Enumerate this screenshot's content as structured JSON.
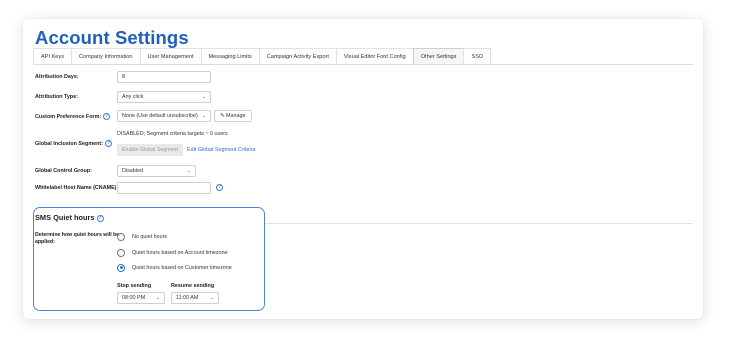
{
  "page": {
    "title": "Account Settings"
  },
  "tabs": [
    {
      "label": "API Keys"
    },
    {
      "label": "Company Information"
    },
    {
      "label": "User Management"
    },
    {
      "label": "Messaging Limits"
    },
    {
      "label": "Campaign Activity Export"
    },
    {
      "label": "Visual Editor Font Config"
    },
    {
      "label": "Other Settings",
      "active": true
    },
    {
      "label": "SSO"
    }
  ],
  "form": {
    "attribution_days": {
      "label": "Attribution Days:",
      "value": "8"
    },
    "attribution_type": {
      "label": "Attribution Type:",
      "value": "Any click"
    },
    "custom_preference_form": {
      "label": "Custom Preference Form:",
      "value": "None (Use default unsubscribe)",
      "manage_label": "Manage"
    },
    "global_inclusion_segment": {
      "label": "Global Inclusion Segment:",
      "status_text": "DISABLED; Segment criteria targets ~ 0 users",
      "enable_label": "Enable Global Segment",
      "edit_label": "Edit Global Segment Criteria"
    },
    "global_control_group": {
      "label": "Global Control Group:",
      "value": "Disabled"
    },
    "whitelabel_host": {
      "label": "Whitelabel Host Name (CNAME):",
      "value": ""
    }
  },
  "sms_quiet_hours": {
    "title": "SMS Quiet hours",
    "description": "Determine how quiet hours will be applied:",
    "options": [
      {
        "label": "No quiet hours",
        "checked": false
      },
      {
        "label": "Quiet hours based on Account timezone",
        "checked": false
      },
      {
        "label": "Quiet hours based on Customer timezone",
        "checked": true
      }
    ],
    "stop_sending": {
      "label": "Stop sending",
      "value": "08:00 PM"
    },
    "resume_sending": {
      "label": "Resume sending",
      "value": "11:00 AM"
    }
  },
  "colors": {
    "accent": "#1f5fbf",
    "link": "#2f6fd0",
    "highlight_border": "#4a86d8"
  },
  "icons": {
    "info": "info-circle-icon",
    "pencil": "pencil-icon",
    "caret": "chevron-down-icon"
  }
}
